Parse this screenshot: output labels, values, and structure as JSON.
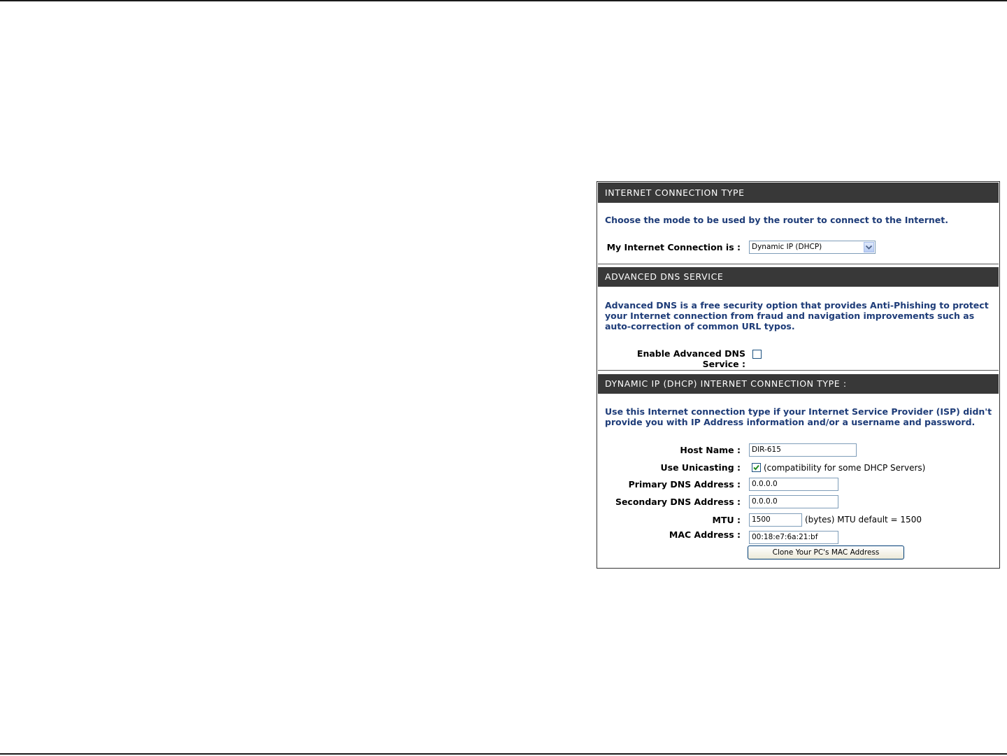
{
  "internet_connection": {
    "header": "INTERNET CONNECTION TYPE",
    "description": "Choose the mode to be used by the router to connect to the Internet.",
    "connection_label": "My Internet Connection is :",
    "connection_value": "Dynamic IP (DHCP)"
  },
  "advanced_dns": {
    "header": "ADVANCED DNS SERVICE",
    "description": "Advanced DNS is a free security option that provides Anti-Phishing to protect your Internet connection from fraud and navigation improvements such as auto-correction of common URL typos.",
    "enable_label": "Enable Advanced DNS Service :",
    "enabled": false
  },
  "dhcp": {
    "header": "DYNAMIC IP (DHCP) INTERNET CONNECTION TYPE :",
    "description": "Use this Internet connection type if your Internet Service Provider (ISP) didn't provide you with IP Address information and/or a username and password.",
    "host_name_label": "Host Name :",
    "host_name_value": "DIR-615",
    "unicasting_label": "Use Unicasting :",
    "unicasting_checked": true,
    "unicasting_note": "(compatibility for some DHCP Servers)",
    "primary_dns_label": "Primary DNS Address :",
    "primary_dns_value": "0.0.0.0",
    "secondary_dns_label": "Secondary DNS Address :",
    "secondary_dns_value": "0.0.0.0",
    "mtu_label": "MTU :",
    "mtu_value": "1500",
    "mtu_note": "(bytes) MTU default = 1500",
    "mac_label": "MAC Address :",
    "mac_value": "00:18:e7:6a:21:bf",
    "clone_button_label": "Clone Your PC's MAC Address"
  },
  "colors": {
    "header_bg": "#383838",
    "description_text": "#1e3c78",
    "checkbox_check": "#1f8a1f"
  },
  "icons": {
    "select_arrow": "chevron-down-icon",
    "unicasting_check": "checkmark-icon"
  }
}
